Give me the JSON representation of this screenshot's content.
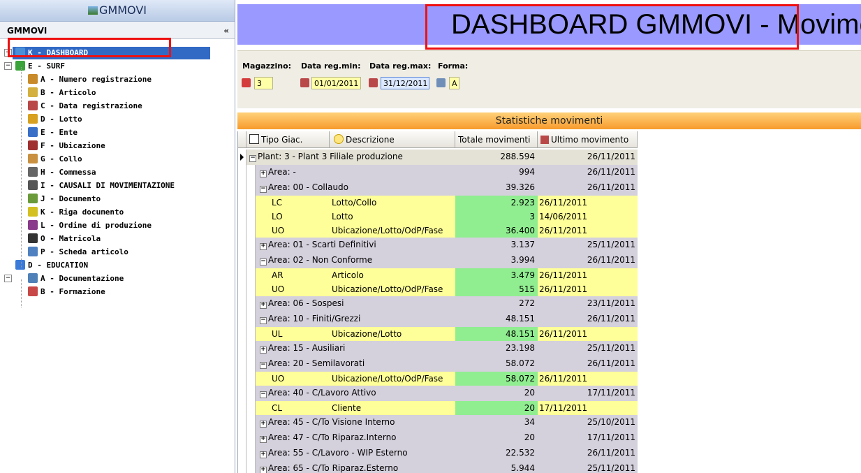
{
  "app": {
    "title": "GMMOVI"
  },
  "panel": {
    "header": "GMMOVI",
    "collapse": "«"
  },
  "tree": [
    {
      "label": "K - DASHBOARD",
      "level": 1,
      "icon": "dashboard-icon",
      "color": "#4a90d9",
      "selected": true
    },
    {
      "label": "E - SURF",
      "level": 1,
      "icon": "refresh-icon",
      "color": "#3aa33a"
    },
    {
      "label": "A - Numero registrazione",
      "level": 2,
      "icon": "tools-icon",
      "color": "#c98a2a"
    },
    {
      "label": "B - Articolo",
      "level": 2,
      "icon": "article-icon",
      "color": "#d4b040"
    },
    {
      "label": "C - Data registrazione",
      "level": 2,
      "icon": "calendar-icon",
      "color": "#b94848"
    },
    {
      "label": "D - Lotto",
      "level": 2,
      "icon": "lot-icon",
      "color": "#d8a020"
    },
    {
      "label": "E - Ente",
      "level": 2,
      "icon": "person-icon",
      "color": "#3a6fc8"
    },
    {
      "label": "F - Ubicazione",
      "level": 2,
      "icon": "location-icon",
      "color": "#a03030"
    },
    {
      "label": "G - Collo",
      "level": 2,
      "icon": "box-icon",
      "color": "#c89040"
    },
    {
      "label": "H - Commessa",
      "level": 2,
      "icon": "order-icon",
      "color": "#666666"
    },
    {
      "label": "I - CAUSALI DI MOVIMENTAZIONE",
      "level": 2,
      "icon": "grid-icon",
      "color": "#555555"
    },
    {
      "label": "J - Documento",
      "level": 2,
      "icon": "document-icon",
      "color": "#6a9a3a"
    },
    {
      "label": "K - Riga documento",
      "level": 2,
      "icon": "doc-line-icon",
      "color": "#d4c020"
    },
    {
      "label": "L - Ordine di produzione",
      "level": 2,
      "icon": "production-order-icon",
      "color": "#8a3a8a"
    },
    {
      "label": "O - Matricola",
      "level": 2,
      "icon": "barcode-icon",
      "color": "#333333"
    },
    {
      "label": "P - Scheda articolo",
      "level": 2,
      "icon": "article-sheet-icon",
      "color": "#5080c0"
    },
    {
      "label": "D - EDUCATION",
      "level": 1,
      "icon": "info-icon",
      "color": "#3a7ad8"
    },
    {
      "label": "A - Documentazione",
      "level": 2,
      "icon": "book-icon",
      "color": "#5080b8"
    },
    {
      "label": "B - Formazione",
      "level": 2,
      "icon": "training-icon",
      "color": "#c84848"
    }
  ],
  "banner": {
    "title": "DASHBOARD GMMOVI - Movimentazioni"
  },
  "filters": {
    "magazzino": {
      "label": "Magazzino:",
      "value": "3"
    },
    "data_min": {
      "label": "Data reg.min:",
      "value": "01/01/2011"
    },
    "data_max": {
      "label": "Data reg.max:",
      "value": "31/12/2011"
    },
    "forma": {
      "label": "Forma:",
      "value": "A"
    }
  },
  "stats": {
    "title": "Statistiche movimenti",
    "columns": [
      "Tipo Giac.",
      "Descrizione",
      "Totale movimenti",
      "Ultimo movimento"
    ],
    "rows": [
      {
        "kind": "plant",
        "label": "Plant: 3 - Plant 3 Filiale produzione",
        "total": "288.594",
        "date": "26/11/2011",
        "sign": "−"
      },
      {
        "kind": "area",
        "label": "Area: -",
        "total": "994",
        "date": "26/11/2011",
        "sign": "+"
      },
      {
        "kind": "area",
        "label": "Area: 00 - Collaudo",
        "total": "39.326",
        "date": "26/11/2011",
        "sign": "−"
      },
      {
        "kind": "detail",
        "code": "LC",
        "desc": "Lotto/Collo",
        "total": "2.923",
        "date": "26/11/2011"
      },
      {
        "kind": "detail",
        "code": "LO",
        "desc": "Lotto",
        "total": "3",
        "date": "14/06/2011"
      },
      {
        "kind": "detail",
        "code": "UO",
        "desc": "Ubicazione/Lotto/OdP/Fase",
        "total": "36.400",
        "date": "26/11/2011"
      },
      {
        "kind": "area",
        "label": "Area: 01 - Scarti Definitivi",
        "total": "3.137",
        "date": "25/11/2011",
        "sign": "+"
      },
      {
        "kind": "area",
        "label": "Area: 02 - Non Conforme",
        "total": "3.994",
        "date": "26/11/2011",
        "sign": "−"
      },
      {
        "kind": "detail",
        "code": "AR",
        "desc": "Articolo",
        "total": "3.479",
        "date": "26/11/2011"
      },
      {
        "kind": "detail",
        "code": "UO",
        "desc": "Ubicazione/Lotto/OdP/Fase",
        "total": "515",
        "date": "26/11/2011"
      },
      {
        "kind": "area",
        "label": "Area: 06 - Sospesi",
        "total": "272",
        "date": "23/11/2011",
        "sign": "+"
      },
      {
        "kind": "area",
        "label": "Area: 10 - Finiti/Grezzi",
        "total": "48.151",
        "date": "26/11/2011",
        "sign": "−"
      },
      {
        "kind": "detail",
        "code": "UL",
        "desc": "Ubicazione/Lotto",
        "total": "48.151",
        "date": "26/11/2011"
      },
      {
        "kind": "area",
        "label": "Area: 15 - Ausiliari",
        "total": "23.198",
        "date": "25/11/2011",
        "sign": "+"
      },
      {
        "kind": "area",
        "label": "Area: 20 - Semilavorati",
        "total": "58.072",
        "date": "26/11/2011",
        "sign": "−"
      },
      {
        "kind": "detail",
        "code": "UO",
        "desc": "Ubicazione/Lotto/OdP/Fase",
        "total": "58.072",
        "date": "26/11/2011"
      },
      {
        "kind": "area",
        "label": "Area: 40 - C/Lavoro Attivo",
        "total": "20",
        "date": "17/11/2011",
        "sign": "−"
      },
      {
        "kind": "detail",
        "code": "CL",
        "desc": "Cliente",
        "total": "20",
        "date": "17/11/2011"
      },
      {
        "kind": "area",
        "label": "Area: 45 - C/To Visione Interno",
        "total": "34",
        "date": "25/10/2011",
        "sign": "+"
      },
      {
        "kind": "area",
        "label": "Area: 47 - C/To Riparaz.Interno",
        "total": "20",
        "date": "17/11/2011",
        "sign": "+"
      },
      {
        "kind": "area",
        "label": "Area: 55 - C/Lavoro - WIP Esterno",
        "total": "22.532",
        "date": "26/11/2011",
        "sign": "+"
      },
      {
        "kind": "area",
        "label": "Area: 65 - C/To Riparaz.Esterno",
        "total": "5.944",
        "date": "25/11/2011",
        "sign": "+"
      }
    ]
  }
}
